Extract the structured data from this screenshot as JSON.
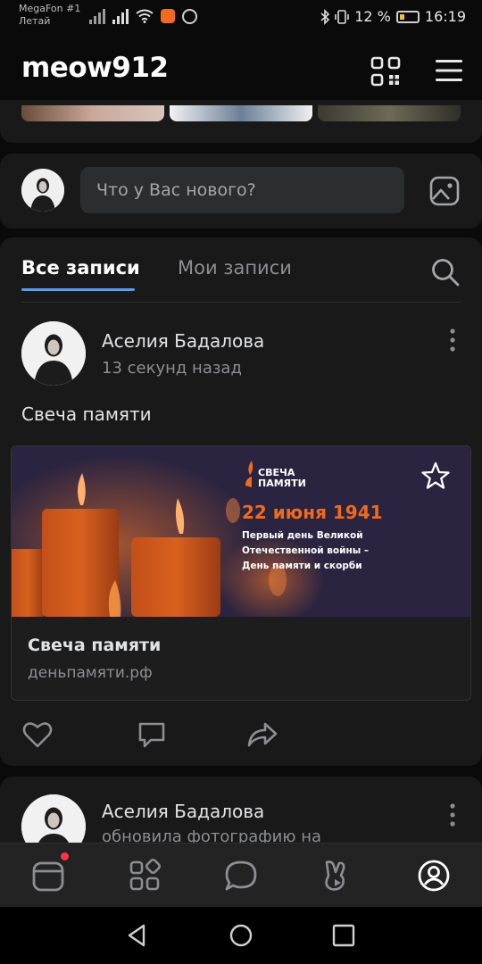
{
  "status_bar": {
    "carrier_line1": "MegaFon #1",
    "carrier_line2": "Летай",
    "battery": "12 %",
    "time": "16:19"
  },
  "header": {
    "username": "meow912",
    "icons": [
      "qr-code-icon",
      "menu-icon"
    ]
  },
  "composer": {
    "placeholder": "Что у Вас нового?",
    "icons": [
      "photo-icon"
    ]
  },
  "feed": {
    "tabs": [
      {
        "label": "Все записи",
        "active": true
      },
      {
        "label": "Мои записи",
        "active": false
      }
    ],
    "posts": [
      {
        "author": "Аселия Бадалова",
        "time": "13 секунд назад",
        "text": "Свеча памяти",
        "link": {
          "banner": {
            "logo_line1": "СВЕЧА",
            "logo_line2": "ПАМЯТИ",
            "date": "22 июня 1941",
            "sub_line1": "Первый день Великой",
            "sub_line2": "Отечественной войны –",
            "sub_line3": "День памяти и скорби"
          },
          "title": "Свеча памяти",
          "url": "деньпамяти.рф"
        },
        "actions": [
          "heart-icon",
          "comment-icon",
          "share-icon"
        ]
      },
      {
        "author": "Аселия Бадалова",
        "subtitle": "обновила фотографию на"
      }
    ]
  },
  "bottom_nav": {
    "items": [
      "news-icon",
      "services-icon",
      "messages-icon",
      "clips-icon",
      "profile-icon"
    ],
    "active": "profile-icon",
    "has_notification": "news-icon"
  },
  "colors": {
    "accent": "#5e9be6",
    "background": "#0a0a0a",
    "card": "#191919",
    "banner_orange": "#f26a1b",
    "notification": "#ff3347"
  }
}
